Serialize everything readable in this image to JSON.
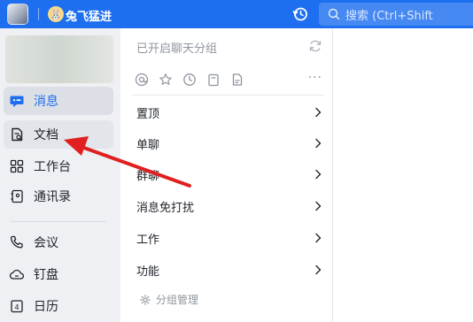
{
  "topbar": {
    "username": "兔飞猛进",
    "avatar_glyph": "🐰",
    "search_placeholder": "搜索 (Ctrl+Shift",
    "icons": {
      "logo": "app-logo",
      "history": "history-icon",
      "search": "search-icon"
    },
    "bg_color": "#1e6ff0"
  },
  "leftnav": {
    "items": [
      {
        "key": "messages",
        "label": "消息",
        "icon": "chat-bubble-icon",
        "active": true
      },
      {
        "key": "docs",
        "label": "文档",
        "icon": "document-icon",
        "active": false
      },
      {
        "key": "workbench",
        "label": "工作台",
        "icon": "grid-icon",
        "active": false
      },
      {
        "key": "contacts",
        "label": "通讯录",
        "icon": "contacts-icon",
        "active": false
      },
      {
        "key": "meetings",
        "label": "会议",
        "icon": "phone-icon",
        "active": false
      },
      {
        "key": "drive",
        "label": "钉盘",
        "icon": "cloud-icon",
        "active": false
      },
      {
        "key": "calendar",
        "label": "日历",
        "icon": "calendar-icon",
        "active": false
      }
    ],
    "calendar_day": "4"
  },
  "midpanel": {
    "header": "已开启聊天分组",
    "toolbar_icons": [
      "at-icon",
      "star-icon",
      "clock-icon",
      "clipboard-icon",
      "file-icon",
      "more-icon"
    ],
    "more_glyph": "···",
    "groups": [
      {
        "label": "置顶"
      },
      {
        "label": "单聊"
      },
      {
        "label": "群聊"
      },
      {
        "label": "消息免打扰"
      },
      {
        "label": "工作"
      },
      {
        "label": "功能"
      }
    ],
    "manage_label": "分组管理"
  },
  "colors": {
    "accent": "#1e6ff0",
    "annotation_arrow": "#e02020",
    "muted_text": "#8f959e"
  }
}
